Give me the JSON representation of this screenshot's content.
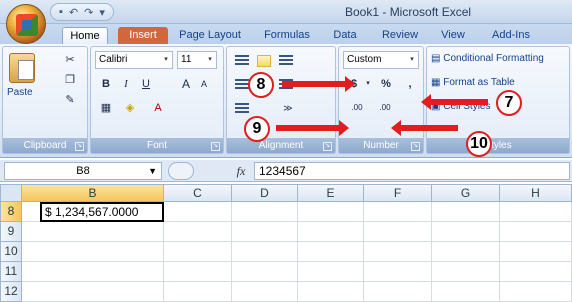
{
  "window": {
    "title": "Book1 - Microsoft Excel"
  },
  "tabs": [
    {
      "label": "Home"
    },
    {
      "label": "Insert"
    },
    {
      "label": "Page Layout"
    },
    {
      "label": "Formulas"
    },
    {
      "label": "Data"
    },
    {
      "label": "Review"
    },
    {
      "label": "View"
    },
    {
      "label": "Add-Ins"
    }
  ],
  "ribbon": {
    "clipboard": {
      "label": "Clipboard",
      "paste_label": "Paste"
    },
    "font": {
      "label": "Font",
      "font_name": "Calibri",
      "font_size": "11",
      "bold": "B",
      "italic": "I",
      "underline": "U",
      "grow": "A",
      "shrink": "A",
      "font_color": "A"
    },
    "alignment": {
      "label": "Alignment"
    },
    "number": {
      "label": "Number",
      "format": "Custom",
      "currency": "$",
      "percent": "%",
      "comma": ",",
      "increase_decimal": ".00",
      "decrease_decimal": ".00"
    },
    "styles": {
      "label": "Styles",
      "conditional_formatting": "Conditional Formatting",
      "format_as_table": "Format as Table",
      "cell_styles": "Cell Styles"
    }
  },
  "formula_bar": {
    "name_box": "B8",
    "fx": "fx",
    "value": "1234567"
  },
  "grid": {
    "columns": [
      "B",
      "C",
      "D",
      "E",
      "F",
      "G",
      "H"
    ],
    "rows": [
      "8",
      "9",
      "10",
      "11",
      "12"
    ],
    "cell_b8": "$ 1,234,567.0000"
  },
  "callouts": {
    "c7": "7",
    "c8": "8",
    "c9": "9",
    "c10": "10"
  },
  "colors": {
    "arrow": "#e11d1d",
    "selection": "#f6c65b",
    "ribbon": "#dde8f5"
  }
}
